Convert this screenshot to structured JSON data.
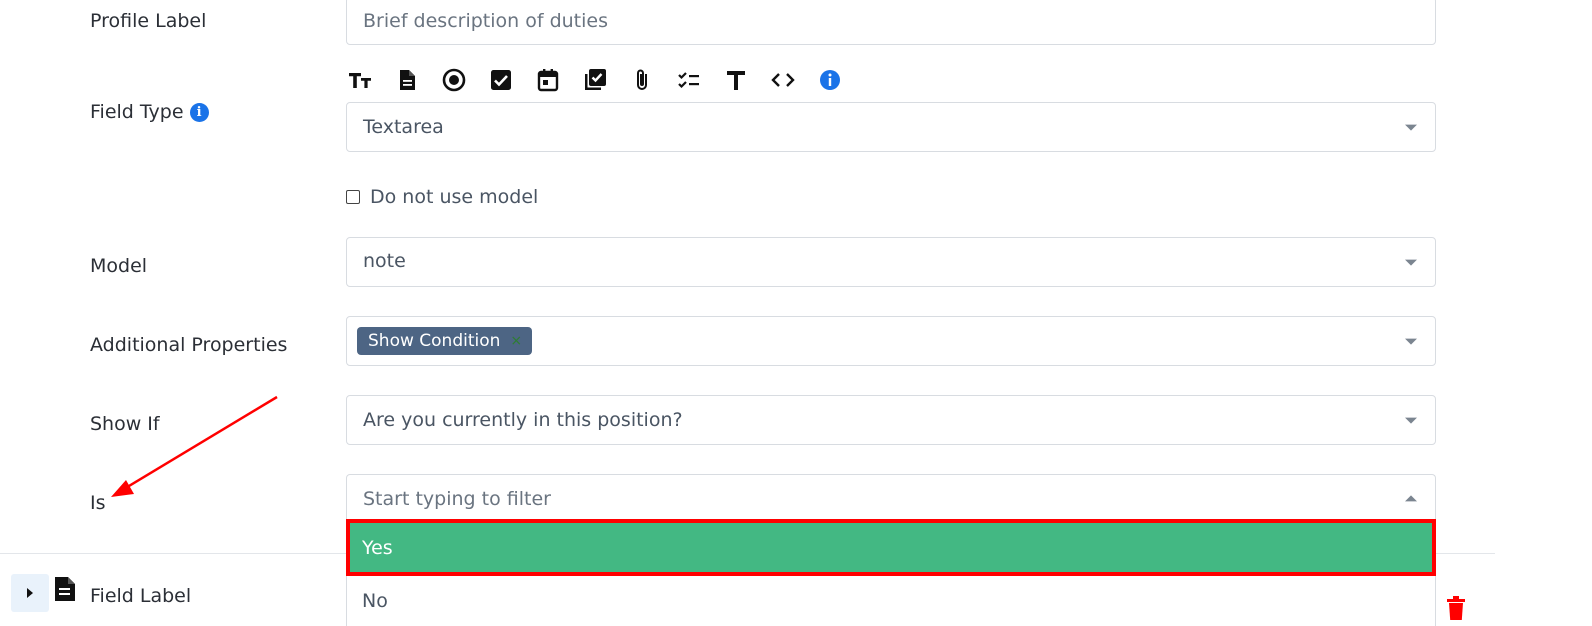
{
  "profile_label": {
    "label": "Profile Label",
    "placeholder": "Brief description of duties"
  },
  "field_type": {
    "label": "Field Type",
    "info_glyph": "i",
    "value": "Textarea",
    "toolbar_icons": [
      "text-size-icon",
      "document-icon",
      "radio-icon",
      "checkbox-icon",
      "calendar-icon",
      "multi-checkbox-icon",
      "paperclip-icon",
      "checklist-icon",
      "text-icon",
      "code-icon",
      "info-icon"
    ]
  },
  "do_not_use_model": {
    "label": "Do not use model",
    "checked": false
  },
  "model": {
    "label": "Model",
    "value": "note"
  },
  "additional_properties": {
    "label": "Additional Properties",
    "tag": "Show Condition",
    "tag_remove": "×"
  },
  "show_if": {
    "label": "Show If",
    "value": "Are you currently in this position?"
  },
  "is": {
    "label": "Is",
    "placeholder": "Start typing to filter",
    "options": [
      "Yes",
      "No"
    ],
    "highlighted": "Yes"
  },
  "next_field": {
    "label": "Field Label"
  },
  "colors": {
    "accent": "#1a73e8",
    "highlight_option": "#43b883",
    "annotation": "#ff0000",
    "tag": "#4d6584",
    "delete": "#ff0000"
  }
}
